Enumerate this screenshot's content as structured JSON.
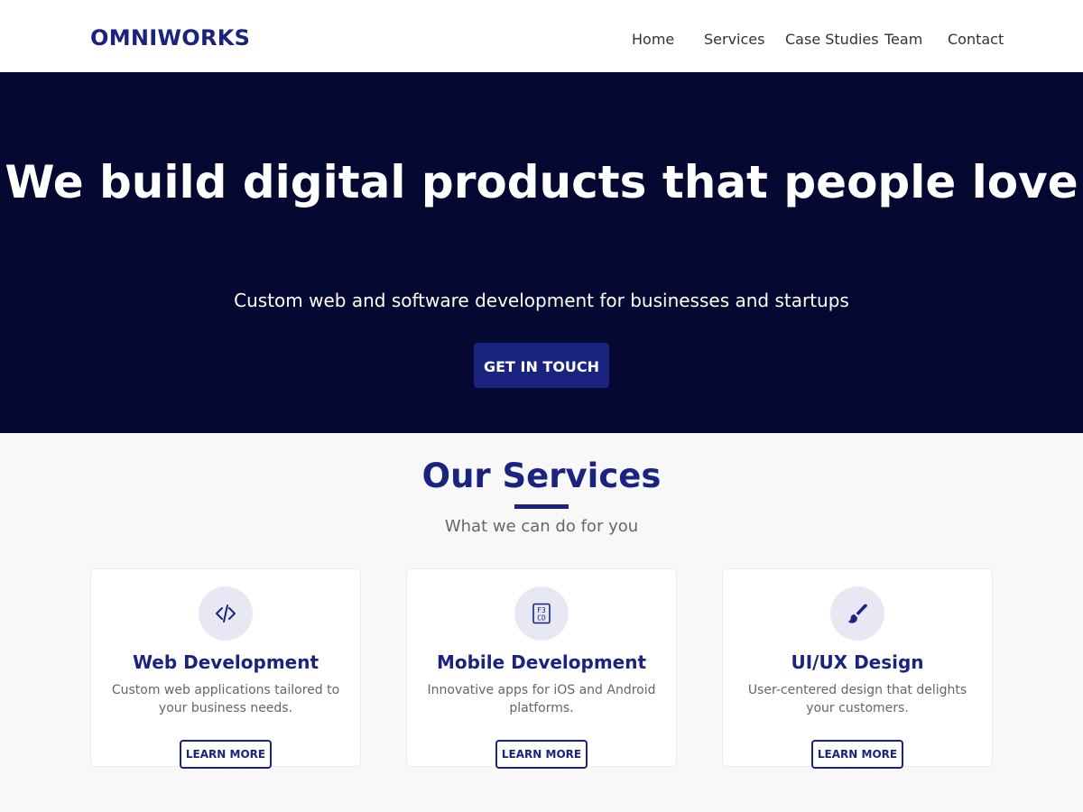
{
  "brand": {
    "name": "OMNIWORKS",
    "color": "#1a237e"
  },
  "nav": {
    "items": [
      {
        "label": "Home"
      },
      {
        "label": "Services"
      },
      {
        "label": "Case Studies"
      },
      {
        "label": "Team"
      },
      {
        "label": "Contact"
      }
    ]
  },
  "hero": {
    "title": "We build digital products that people love",
    "subtitle": "Custom web and software development for businesses and startups",
    "cta_label": "GET IN TOUCH",
    "background": "#050830"
  },
  "services": {
    "title": "Our Services",
    "subtitle": "What we can do for you",
    "cards": [
      {
        "icon": "code-icon",
        "title": "Web Development",
        "description": "Custom web applications tailored to your business needs.",
        "button_label": "LEARN MORE"
      },
      {
        "icon": "mobile-icon",
        "title": "Mobile Development",
        "description": "Innovative apps for iOS and Android platforms.",
        "button_label": "LEARN MORE"
      },
      {
        "icon": "paintbrush-icon",
        "title": "UI/UX Design",
        "description": "User-centered design that delights your customers.",
        "button_label": "LEARN MORE"
      }
    ]
  }
}
